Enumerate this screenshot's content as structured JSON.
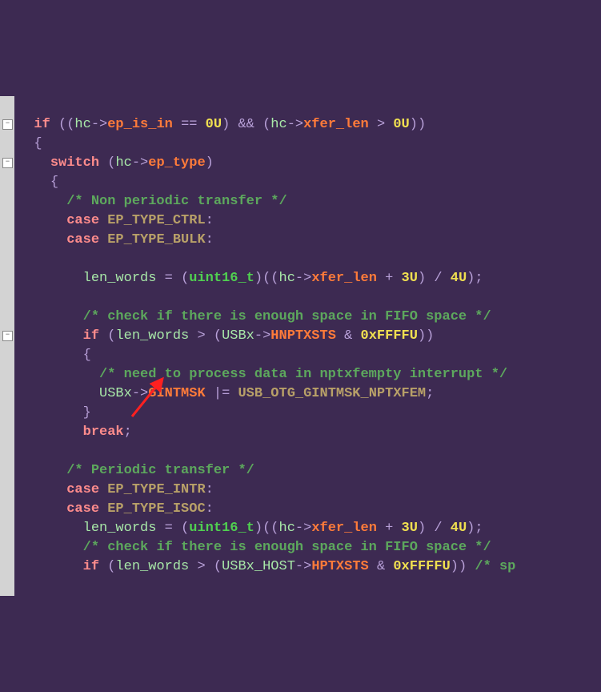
{
  "code": {
    "kw_if": "if",
    "kw_switch": "switch",
    "kw_case": "case",
    "kw_break": "break",
    "id_hc": "hc",
    "mem_ep_is_in": "ep_is_in",
    "mem_ep_type": "ep_type",
    "mem_xfer_len": "xfer_len",
    "mem_HNPTXSTS": "HNPTXSTS",
    "mem_GINTMSK": "GINTMSK",
    "mem_HPTXSTS": "HPTXSTS",
    "id_len_words": "len_words",
    "id_USBx": "USBx",
    "id_USBx_HOST": "USBx_HOST",
    "ty_uint16_t": "uint16_t",
    "num_0U": "0U",
    "num_3U": "3U",
    "num_4U": "4U",
    "num_0xFFFFU": "0xFFFFU",
    "cap_EP_TYPE_CTRL": "EP_TYPE_CTRL",
    "cap_EP_TYPE_BULK": "EP_TYPE_BULK",
    "cap_EP_TYPE_INTR": "EP_TYPE_INTR",
    "cap_EP_TYPE_ISOC": "EP_TYPE_ISOC",
    "cap_USB_OTG_GINTMSK_NPTXFEM": "USB_OTG_GINTMSK_NPTXFEM",
    "cm_nonperiodic": "/* Non periodic transfer */",
    "cm_checkfifo": "/* check if there is enough space in FIFO space */",
    "cm_needproc": "/* need to process data in nptxfempty interrupt */",
    "cm_periodic": "/* Periodic transfer */",
    "cm_sp": "/* sp",
    "arrow": "->",
    "eq": "==",
    "and": "&&",
    "gt": ">",
    "amp": "&",
    "oreq": "|=",
    "plus": "+",
    "div": "/",
    "assign": "=",
    "semi": ";",
    "colon": ":",
    "lp": "(",
    "rp": ")",
    "lb": "{",
    "rb": "}",
    "fold_minus": "−"
  }
}
